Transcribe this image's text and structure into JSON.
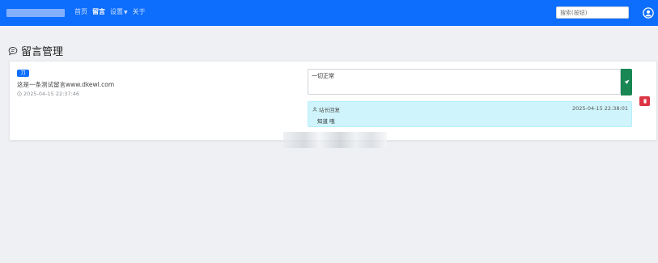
{
  "nav": {
    "items": [
      {
        "label": "首页",
        "active": false
      },
      {
        "label": "留言",
        "active": true
      },
      {
        "label": "设置",
        "active": false,
        "dropdown": true
      },
      {
        "label": "关于",
        "active": false
      }
    ]
  },
  "search": {
    "placeholder": "搜索(按钮)"
  },
  "page": {
    "title": "留言管理"
  },
  "message": {
    "badge": "刀",
    "text": "这是一条测试留言www.dkewl.com",
    "time": "2025-04-15 22:37:46",
    "reply_input_value": "一切正常",
    "reply": {
      "author": "站长回复",
      "time": "2025-04-15 22:38:01",
      "text": "知道 哦"
    }
  },
  "colors": {
    "topbar": "#0d6efd",
    "send_button": "#198754",
    "delete_button": "#dc3545",
    "reply_bg": "#cff4fc"
  }
}
